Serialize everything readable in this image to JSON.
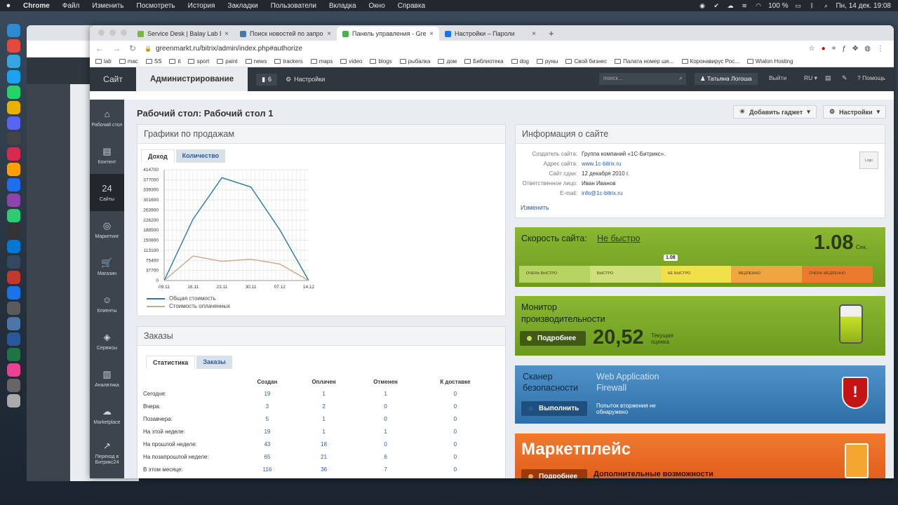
{
  "mac_menu": {
    "app": "Chrome",
    "items": [
      "Файл",
      "Изменить",
      "Посмотреть",
      "История",
      "Закладки",
      "Пользователи",
      "Вкладка",
      "Окно",
      "Справка"
    ],
    "battery": "100 %",
    "clock": "Пн, 14 дек.  19:08"
  },
  "browser": {
    "tabs": [
      {
        "label": "Service Desk | Balay Lab Balay",
        "color": "#7cb342"
      },
      {
        "label": "Поиск новостей по запросу «...",
        "color": "#4a76a8"
      },
      {
        "label": "Панель управления - GreenM...",
        "color": "#4caf50"
      },
      {
        "label": "Настройки – Пароли",
        "color": "#1a73e8"
      }
    ],
    "url": "greenmarkt.ru/bitrix/admin/index.php#authorize",
    "bookmarks": [
      "lab",
      "mac",
      "SS",
      "it",
      "sport",
      "paint",
      "news",
      "trackers",
      "maps",
      "video",
      "blogs",
      "рыбалка",
      "дом",
      "Библиотека",
      "dog",
      "руны",
      "Свой бизнес",
      "Палата номер ше...",
      "Коронавирус Рос...",
      "Wialon Hosting"
    ]
  },
  "topbar": {
    "site": "Сайт",
    "admin": "Администрирование",
    "notifications": "6",
    "settings": "Настройки",
    "search_placeholder": "поиск...",
    "user": "Татьяна Логоша",
    "logout": "Выйти",
    "lang": "RU",
    "help": "Помощь"
  },
  "leftnav": [
    {
      "label": "Рабочий стол",
      "icon": "⌂"
    },
    {
      "label": "Контент",
      "icon": "▤"
    },
    {
      "label": "Сайты",
      "icon": "24"
    },
    {
      "label": "Маркетинг",
      "icon": "◎"
    },
    {
      "label": "Магазин",
      "icon": "🛒"
    },
    {
      "label": "Клиенты",
      "icon": "☺"
    },
    {
      "label": "Сервисы",
      "icon": "◈"
    },
    {
      "label": "Аналитика",
      "icon": "▥"
    },
    {
      "label": "Marketplace",
      "icon": "☁"
    },
    {
      "label": "Переход в Битрикс24",
      "icon": "↗"
    }
  ],
  "page": {
    "title": "Рабочий стол: Рабочий стол 1",
    "add_gadget": "Добавить гаджет",
    "settings": "Настройки"
  },
  "sales": {
    "title": "Графики по продажам",
    "tabs": [
      "Доход",
      "Количество"
    ],
    "legend": [
      "Общая стоимость",
      "Стоимость оплаченных"
    ]
  },
  "chart_data": {
    "type": "line",
    "x": [
      "09.11",
      "16.11",
      "23.11",
      "30.11",
      "07.12",
      "14.12"
    ],
    "yticks": [
      0,
      37700,
      75400,
      113100,
      150800,
      188500,
      226200,
      263900,
      301600,
      339300,
      377000,
      414700
    ],
    "ylim": [
      0,
      414700
    ],
    "series": [
      {
        "name": "Общая стоимость",
        "color": "#2a7a9a",
        "values": [
          0,
          230000,
          385000,
          350000,
          190000,
          0
        ]
      },
      {
        "name": "Стоимость оплаченных",
        "color": "#c9a88c",
        "values": [
          0,
          92000,
          72000,
          80000,
          62000,
          0
        ]
      }
    ]
  },
  "orders": {
    "title": "Заказы",
    "tabs": [
      "Статистика",
      "Заказы"
    ],
    "columns": [
      "",
      "Создан",
      "Оплачен",
      "Отменен",
      "К доставке"
    ],
    "rows": [
      [
        "Сегодня:",
        "19",
        "1",
        "1",
        "0"
      ],
      [
        "Вчера:",
        "3",
        "2",
        "0",
        "0"
      ],
      [
        "Позавчера:",
        "5",
        "1",
        "0",
        "0"
      ],
      [
        "На этой неделе:",
        "19",
        "1",
        "1",
        "0"
      ],
      [
        "На прошлой неделе:",
        "43",
        "18",
        "0",
        "0"
      ],
      [
        "На позапрошлой неделе:",
        "65",
        "21",
        "6",
        "0"
      ],
      [
        "В этом месяце:",
        "116",
        "36",
        "7",
        "0"
      ]
    ]
  },
  "siteinfo": {
    "title": "Информация о сайте",
    "rows": [
      {
        "k": "Создатель сайта:",
        "v": "Группа компаний «1С-Битрикс».",
        "link": false
      },
      {
        "k": "Адрес сайта:",
        "v": "www.1c-bitrix.ru",
        "link": true
      },
      {
        "k": "Сайт сдан:",
        "v": "12 декабря 2010 г.",
        "link": false
      },
      {
        "k": "Ответственное лицо:",
        "v": "Иван Иванов",
        "link": false
      },
      {
        "k": "E-mail:",
        "v": "info@1c-bitrix.ru",
        "link": true
      }
    ],
    "edit": "Изменить",
    "logo": "Logo"
  },
  "speed": {
    "title": "Скорость сайта:",
    "status": "Не быстро",
    "value": "1.08",
    "unit": "Сек.",
    "marker": "1.08",
    "segments": [
      "ОЧЕНЬ БЫСТРО",
      "БЫСТРО",
      "НЕ БЫСТРО",
      "МЕДЛЕННО",
      "ОЧЕНЬ МЕДЛЕННО"
    ]
  },
  "perf": {
    "title1": "Монитор",
    "title2": "производительности",
    "button": "Подробнее",
    "value": "20,52",
    "note1": "Текущая",
    "note2": "оценка"
  },
  "security": {
    "title1": "Сканер",
    "title2": "безопасности",
    "waf1": "Web Application",
    "waf2": "Firewall",
    "button": "Выполнить",
    "note1": "Попыток вторжения не",
    "note2": "обнаружено"
  },
  "marketplace": {
    "title": "Маркетплейс",
    "button": "Подробнее",
    "note": "Дополнительные возможности"
  }
}
